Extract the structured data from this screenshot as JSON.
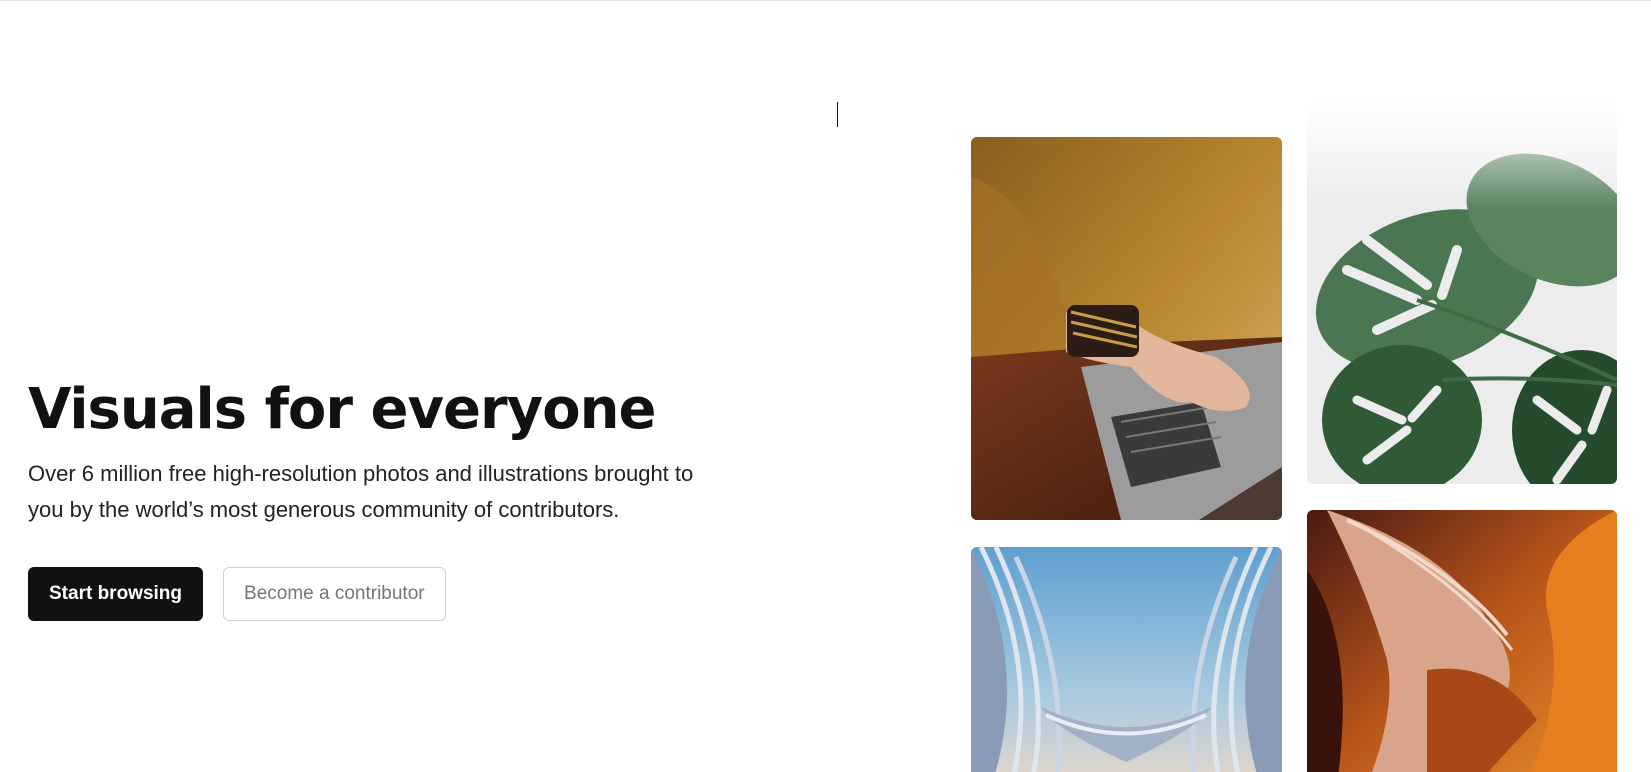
{
  "hero": {
    "title": "Visuals for everyone",
    "subtitle": "Over 6 million free high-resolution photos and illustrations brought to you by the world’s most generous community of contributors.",
    "primary_button": "Start browsing",
    "secondary_button": "Become a contributor"
  },
  "gallery": {
    "photos": [
      "sweater-laptop-photo",
      "monstera-leaf-photo",
      "curved-building-photo",
      "canyon-rock-photo"
    ]
  },
  "colors": {
    "primary_button_bg": "#111111",
    "secondary_button_border": "#d1d1d1",
    "secondary_button_text": "#767676"
  }
}
